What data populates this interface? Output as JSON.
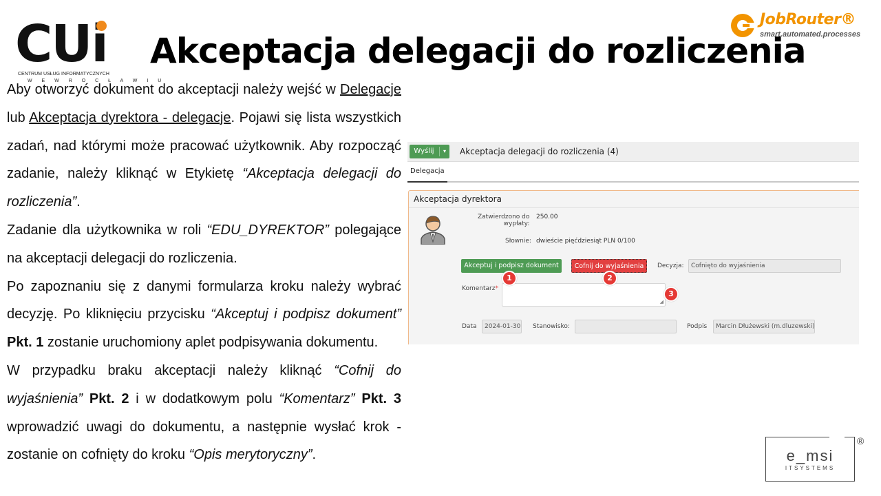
{
  "header": {
    "title": "Akceptacja delegacji do rozliczenia",
    "cui_logo": {
      "mark": "CUi",
      "subtitle": "CENTRUM USŁUG INFORMATYCZNYCH",
      "city": "W E  W R O C Ł A W I U"
    },
    "jobrouter_logo": {
      "name": "JobRouter®",
      "tagline": "smart.automated.processes"
    },
    "emsi_logo": {
      "name": "e_msi",
      "subtitle": "ITSYSTEMS",
      "registered": "®"
    }
  },
  "body": {
    "p1": {
      "t1": "Aby otworzyć dokument do akceptacji należy wejść w ",
      "link1": "Delegacje",
      "t2": " lub ",
      "link2": "Akceptacja dyrektora - delegacje",
      "t3": ". Pojawi się lista wszystkich zadań, nad którymi może pracować użytkownik. Aby rozpocząć zadanie, należy kliknąć w Etykietę ",
      "t4": "“Akceptacja delegacji do rozliczenia”",
      "t5": "."
    },
    "p2": {
      "t1": "Zadanie dla użytkownika w roli ",
      "t2": "“EDU_DYREKTOR”",
      "t3": " polegające na akceptacji delegacji do rozliczenia."
    },
    "p3": {
      "t1": "Po zapoznaniu się z danymi formularza kroku należy wybrać decyzję. Po kliknięciu przycisku ",
      "t2": "“Akceptuj i podpisz dokument”",
      "t3": " ",
      "t4": "Pkt. 1",
      "t5": " zostanie uruchomiony aplet podpisywania dokumentu."
    },
    "p4": {
      "t1": "W przypadku braku akceptacji należy kliknąć ",
      "t2": "“Cofnij do wyjaśnienia”",
      "t3": " ",
      "t4": "Pkt. 2",
      "t5": " i w dodatkowym polu ",
      "t6": "“Komentarz”",
      "t7": " ",
      "t8": "Pkt. 3",
      "t9": " wprowadzić uwagi do dokumentu, a następnie wysłać krok - zostanie on cofnięty do kroku ",
      "t10": "“Opis merytoryczny”",
      "t11": "."
    }
  },
  "screenshot": {
    "send_label": "Wyślij",
    "send_caret": "▾",
    "toolbar_title": "Akceptacja delegacji do rozliczenia (4)",
    "tab_label": "Delegacja",
    "panel_title": "Akceptacja dyrektora",
    "approved_label": "Zatwierdzono do wypłaty:",
    "approved_label_l1": "Zatwierdzono do",
    "approved_label_l2": "wypłaty:",
    "approved_value": "250.00",
    "words_label": "Słownie:",
    "words_value": "dwieście pięćdziesiąt PLN 0/100",
    "accept_button": "Akceptuj i podpisz dokument",
    "reject_button": "Cofnij do wyjaśnienia",
    "decision_label": "Decyzja:",
    "decision_value": "Cofnięto do wyjaśnienia",
    "comment_label": "Komentarz",
    "comment_required": "*",
    "comment_value": "",
    "date_label": "Data",
    "date_value": "2024-01-30",
    "position_label": "Stanowisko:",
    "position_value": "",
    "signature_label": "Podpis",
    "signature_value": "Marcin Dłużewski (m.dluzewski)",
    "markers": [
      "1",
      "2",
      "3"
    ]
  },
  "colors": {
    "green_button": "#4e9b54",
    "red_button": "#e24040",
    "marker": "#e53935",
    "jobrouter_orange": "#f29400",
    "cui_dot": "#f08a1c"
  }
}
